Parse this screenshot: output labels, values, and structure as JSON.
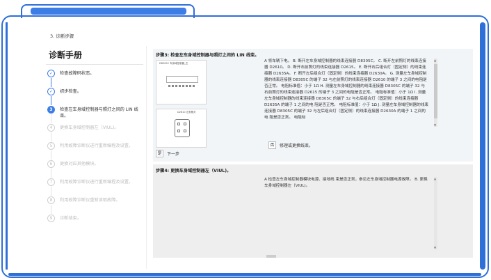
{
  "breadcrumb": "3. 诊断步骤",
  "sidebar": {
    "title": "诊断手册",
    "steps": [
      {
        "num": "✓",
        "label": "检查故障码状态。",
        "state": "done"
      },
      {
        "num": "✓",
        "label": "初步检查。",
        "state": "done"
      },
      {
        "num": "3",
        "label": "检查左车身域控制器与照灯之间的 LIN 线束。",
        "state": "active"
      },
      {
        "num": "4",
        "label": "更换车身域控制器左（VIUL)。",
        "state": "todo"
      },
      {
        "num": "5",
        "label": "利用故障诊断仪进行重新编程及设置。",
        "state": "todo"
      },
      {
        "num": "6",
        "label": "更换对应其他模块。",
        "state": "todo"
      },
      {
        "num": "7",
        "label": "利用故障诊断仪进行重新编程及设置。",
        "state": "todo"
      },
      {
        "num": "8",
        "label": "利用故障诊断仪重新读取故障。",
        "state": "todo"
      },
      {
        "num": "9",
        "label": "诊断结束。",
        "state": "todo"
      }
    ]
  },
  "step3": {
    "title": "步骤3: 检查左车身域控制器与照灯之间的 LIN 线束。",
    "diagram1_title": "D8305C 车身域控制器_左",
    "diagram2_title": "D2610 左前照灯",
    "text": "A 将车辆下电。 B. 断开左车身域控制器的线束连接器 D8305C。 C. 断开左前照灯的线束连接器 D2610。 D. 断开右前照灯的线束连接器 D2615。 E. 断开右后组合灯（固定侧）的线束连接器 D2635A。 F. 断开左后组合灯（固定侧）的线束连接器 D2630A。 G. 测量左车身域控制器的线束连接器 D8305C 的端子 32 与左前照灯的线束连接器 D2610 的端子 3 之间的电阻是否正常。 电阻标准值：小于 1Ω H. 测量左车身域控制器的线束连接器 D8305C 的端子 32 与右前照灯的线束连接器 D2615 的端子 3 之间的电阻是否正常。 电阻标准值：小于 1Ω I. 测量左车身域控制器的线束连接器 D8305C 的端子 32 与右后组合灯（固定侧）的线束连接器 D2635A 的端子 1 之间的电 阻是否正常。 电阻标准值：小于 1Ω J. 测量左车身域控制器的线束连接器 D8305C 的端子 32 与左后组合灯（固定侧）的线束连接器 D2630A 的端子 1 之间的电 阻是否正常。 电阻标",
    "no_box": "否",
    "no_text": "修理或更换线束。",
    "yes_box": "是",
    "yes_text": "下一步"
  },
  "step4": {
    "title": "步骤4: 更换车身域控制器左（VIUL)。",
    "text": "A 检查左车身域控制器模块电源、接地线 束是否正常，参见左车身域控制器电源故障。 B. 更换车身域控制器左（VIUL)。"
  },
  "colors": {
    "accent": "#3d7ee6",
    "frame": "#2f6fd8"
  }
}
